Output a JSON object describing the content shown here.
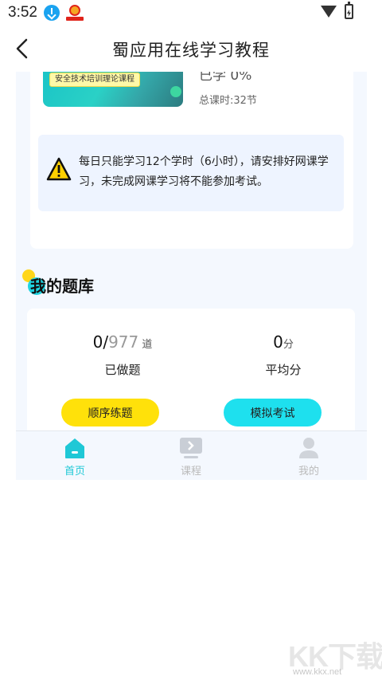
{
  "status_bar": {
    "time": "3:52",
    "icons": [
      "download-icon",
      "app-notification-icon",
      "wifi-icon",
      "battery-charging-icon"
    ]
  },
  "header": {
    "title": "蜀应用在线学习教程",
    "back_icon": "chevron-left-icon"
  },
  "course": {
    "thumbnail_label": "安全技术培训理论课程",
    "learned_label": "已学 0%",
    "total_hours": "总课时:32节"
  },
  "notice": {
    "icon": "warning-triangle-icon",
    "text": "每日只能学习12个学时（6小时），请安排好网课学习，未完成网课学习将不能参加考试。"
  },
  "question_bank": {
    "title": "我的题库",
    "done_count": "0/",
    "total_count": "977",
    "count_unit": " 道",
    "done_label": "已做题",
    "avg_score": "0",
    "score_unit": "分",
    "avg_label": "平均分",
    "sequential_button": "顺序练题",
    "mock_exam_button": "模拟考试"
  },
  "bottom_nav": {
    "items": [
      {
        "label": "首页",
        "icon": "home-icon",
        "active": true
      },
      {
        "label": "课程",
        "icon": "course-play-icon",
        "active": false
      },
      {
        "label": "我的",
        "icon": "user-icon",
        "active": false
      }
    ],
    "active_color": "#1fc8d6"
  },
  "watermark": {
    "logo": "KK下载",
    "url": "www.kkx.net"
  },
  "colors": {
    "accent_yellow": "#ffe10a",
    "accent_cyan": "#1ee0ee",
    "page_bg": "#f4f8fe"
  }
}
